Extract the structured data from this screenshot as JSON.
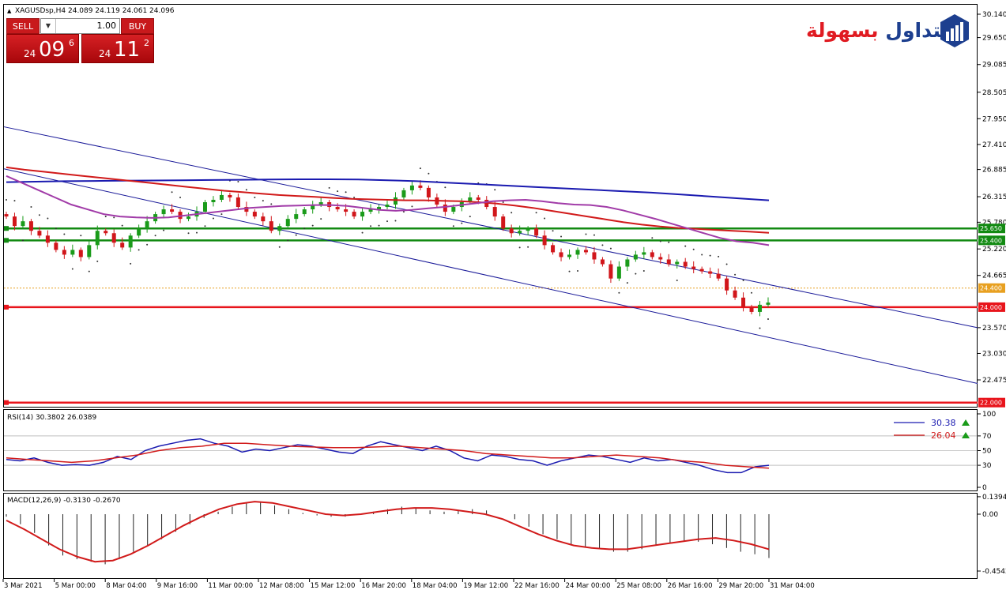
{
  "header": {
    "symbol_line": "XAGUSDsp,H4  24.089 24.119 24.061 24.096"
  },
  "trade_panel": {
    "sell_label": "SELL",
    "buy_label": "BUY",
    "lot_value": "1.00",
    "bid_prefix": "24",
    "bid_big": "09",
    "bid_sup": "6",
    "ask_prefix": "24",
    "ask_big": "11",
    "ask_sup": "2"
  },
  "logo": {
    "text_part1": "التداول",
    "text_part2": "بسهولة"
  },
  "colors": {
    "candle_up": "#1a9b1a",
    "candle_down": "#d1161b",
    "ma_fast": "#a13ba8",
    "ma_mid": "#d11a1a",
    "ma_slow": "#1a1ab0",
    "support_red": "#e8141b",
    "resistance_green": "#128a12",
    "channel": "#1a1a99"
  },
  "chart_data": [
    {
      "type": "candlestick",
      "title": "XAGUSDsp,H4  24.089 24.119 24.061 24.096",
      "y_ticks": [
        "30.140",
        "29.650",
        "29.085",
        "28.505",
        "27.950",
        "27.410",
        "26.885",
        "26.315",
        "25.780",
        "25.220",
        "24.665",
        "23.570",
        "23.030",
        "22.475"
      ],
      "ylim": [
        21.85,
        30.3
      ],
      "x_ticks": [
        "3 Mar 2021",
        "5 Mar 00:00",
        "8 Mar 04:00",
        "9 Mar 16:00",
        "11 Mar 00:00",
        "12 Mar 08:00",
        "15 Mar 12:00",
        "16 Mar 20:00",
        "18 Mar 04:00",
        "19 Mar 12:00",
        "22 Mar 16:00",
        "24 Mar 00:00",
        "25 Mar 08:00",
        "26 Mar 16:00",
        "29 Mar 20:00",
        "31 Mar 04:00"
      ],
      "horizontal_levels": [
        {
          "label": "25.650",
          "value": 25.65,
          "color": "#128a12"
        },
        {
          "label": "25.400",
          "value": 25.4,
          "color": "#128a12"
        },
        {
          "label": "24.400",
          "value": 24.4,
          "color": "#e8a020",
          "style": "dotted"
        },
        {
          "label": "24.000",
          "value": 24.0,
          "color": "#e8141b"
        },
        {
          "label": "22.000",
          "value": 22.0,
          "color": "#e8141b"
        }
      ],
      "channel_lines": [
        {
          "from": [
            0,
            27.78
          ],
          "to": [
            1.0,
            23.57
          ]
        },
        {
          "from": [
            0,
            26.9
          ],
          "to": [
            1.0,
            22.4
          ]
        }
      ],
      "close_path": [
        25.9,
        25.7,
        25.8,
        25.6,
        25.5,
        25.35,
        25.2,
        25.1,
        25.2,
        25.05,
        25.3,
        25.6,
        25.55,
        25.35,
        25.25,
        25.5,
        25.65,
        25.8,
        25.95,
        26.05,
        26.0,
        25.85,
        25.9,
        26.0,
        26.2,
        26.25,
        26.35,
        26.3,
        26.1,
        26.0,
        25.9,
        25.8,
        25.6,
        25.7,
        25.85,
        25.95,
        26.05,
        26.15,
        26.2,
        26.1,
        26.05,
        26.0,
        25.9,
        26.0,
        26.05,
        26.1,
        26.15,
        26.3,
        26.45,
        26.55,
        26.5,
        26.3,
        26.15,
        26.0,
        26.1,
        26.2,
        26.3,
        26.25,
        26.1,
        25.9,
        25.65,
        25.55,
        25.6,
        25.65,
        25.5,
        25.3,
        25.15,
        25.05,
        25.1,
        25.2,
        25.15,
        25.0,
        24.9,
        24.6,
        24.85,
        25.0,
        25.1,
        25.15,
        25.05,
        25.0,
        24.9,
        24.95,
        24.85,
        24.8,
        24.75,
        24.7,
        24.6,
        24.35,
        24.2,
        24.0,
        23.9,
        24.05,
        24.096
      ],
      "ma_fast_path": [
        26.75,
        26.6,
        26.45,
        26.3,
        26.15,
        26.05,
        25.95,
        25.9,
        25.88,
        25.87,
        25.88,
        25.92,
        25.96,
        26.0,
        26.04,
        26.08,
        26.1,
        26.12,
        26.13,
        26.14,
        26.14,
        26.12,
        26.08,
        26.04,
        26.02,
        26.04,
        26.07,
        26.1,
        26.14,
        26.18,
        26.22,
        26.24,
        26.25,
        26.22,
        26.18,
        26.15,
        26.14,
        26.1,
        26.03,
        25.94,
        25.85,
        25.75,
        25.65,
        25.55,
        25.45,
        25.38,
        25.35,
        25.3
      ],
      "ma_mid_path": [
        26.93,
        26.88,
        26.84,
        26.8,
        26.76,
        26.72,
        26.68,
        26.64,
        26.6,
        26.56,
        26.52,
        26.48,
        26.44,
        26.41,
        26.38,
        26.35,
        26.33,
        26.31,
        26.29,
        26.27,
        26.26,
        26.25,
        26.24,
        26.24,
        26.23,
        26.22,
        26.2,
        26.17,
        26.13,
        26.08,
        26.02,
        25.96,
        25.9,
        25.84,
        25.78,
        25.73,
        25.69,
        25.66,
        25.64,
        25.62,
        25.6,
        25.58,
        25.56
      ],
      "ma_slow_path": [
        26.62,
        26.63,
        26.64,
        26.645,
        26.65,
        26.655,
        26.66,
        26.665,
        26.67,
        26.675,
        26.68,
        26.68,
        26.675,
        26.66,
        26.64,
        26.61,
        26.58,
        26.55,
        26.52,
        26.49,
        26.46,
        26.43,
        26.4,
        26.36,
        26.32,
        26.28,
        26.24
      ]
    },
    {
      "type": "line",
      "title": "RSI(14) 30.3802 26.0389",
      "y_ticks": [
        "100",
        "70",
        "50",
        "30",
        "0"
      ],
      "ylim": [
        0,
        100
      ],
      "series": [
        {
          "name": "",
          "last": "30.38",
          "color": "#1a1ab0"
        },
        {
          "name": "",
          "last": "26.04",
          "color": "#d11a1a"
        }
      ],
      "rsi_path": [
        38,
        36,
        40,
        34,
        30,
        31,
        30,
        34,
        42,
        38,
        50,
        56,
        60,
        64,
        66,
        60,
        56,
        48,
        52,
        50,
        54,
        58,
        56,
        52,
        48,
        46,
        56,
        62,
        58,
        54,
        50,
        56,
        50,
        40,
        36,
        44,
        42,
        38,
        36,
        30,
        36,
        40,
        44,
        42,
        38,
        34,
        40,
        36,
        38,
        34,
        30,
        24,
        20,
        20,
        28,
        30
      ],
      "signal_path": [
        40,
        38,
        36,
        34,
        36,
        40,
        44,
        50,
        54,
        56,
        60,
        60,
        58,
        56,
        55,
        54,
        54,
        55,
        56,
        54,
        52,
        50,
        46,
        44,
        42,
        40,
        40,
        42,
        44,
        42,
        40,
        36,
        34,
        30,
        28,
        26
      ]
    },
    {
      "type": "bar",
      "title": "MACD(12,26,9) -0.3130 -0.2670",
      "y_ticks": [
        "0.1394",
        "0.00",
        "-0.4542"
      ],
      "ylim": [
        -0.5,
        0.16
      ],
      "hist_path": [
        -0.02,
        -0.08,
        -0.15,
        -0.25,
        -0.33,
        -0.36,
        -0.38,
        -0.4,
        -0.36,
        -0.3,
        -0.25,
        -0.2,
        -0.14,
        -0.08,
        -0.03,
        0.02,
        0.06,
        0.09,
        0.1,
        0.07,
        0.04,
        0.01,
        -0.01,
        -0.02,
        -0.02,
        0.0,
        0.02,
        0.04,
        0.06,
        0.05,
        0.03,
        0.02,
        0.03,
        0.04,
        0.03,
        0.0,
        -0.04,
        -0.1,
        -0.16,
        -0.2,
        -0.24,
        -0.26,
        -0.28,
        -0.3,
        -0.3,
        -0.28,
        -0.25,
        -0.23,
        -0.22,
        -0.22,
        -0.24,
        -0.27,
        -0.3,
        -0.32,
        -0.35
      ],
      "signal_path": [
        -0.05,
        -0.12,
        -0.2,
        -0.28,
        -0.34,
        -0.38,
        -0.37,
        -0.32,
        -0.25,
        -0.17,
        -0.09,
        -0.02,
        0.04,
        0.08,
        0.1,
        0.09,
        0.06,
        0.03,
        0.0,
        -0.01,
        0.0,
        0.02,
        0.04,
        0.05,
        0.05,
        0.04,
        0.02,
        0.0,
        -0.04,
        -0.1,
        -0.16,
        -0.21,
        -0.25,
        -0.27,
        -0.28,
        -0.28,
        -0.26,
        -0.24,
        -0.22,
        -0.2,
        -0.19,
        -0.21,
        -0.24,
        -0.28
      ]
    }
  ]
}
